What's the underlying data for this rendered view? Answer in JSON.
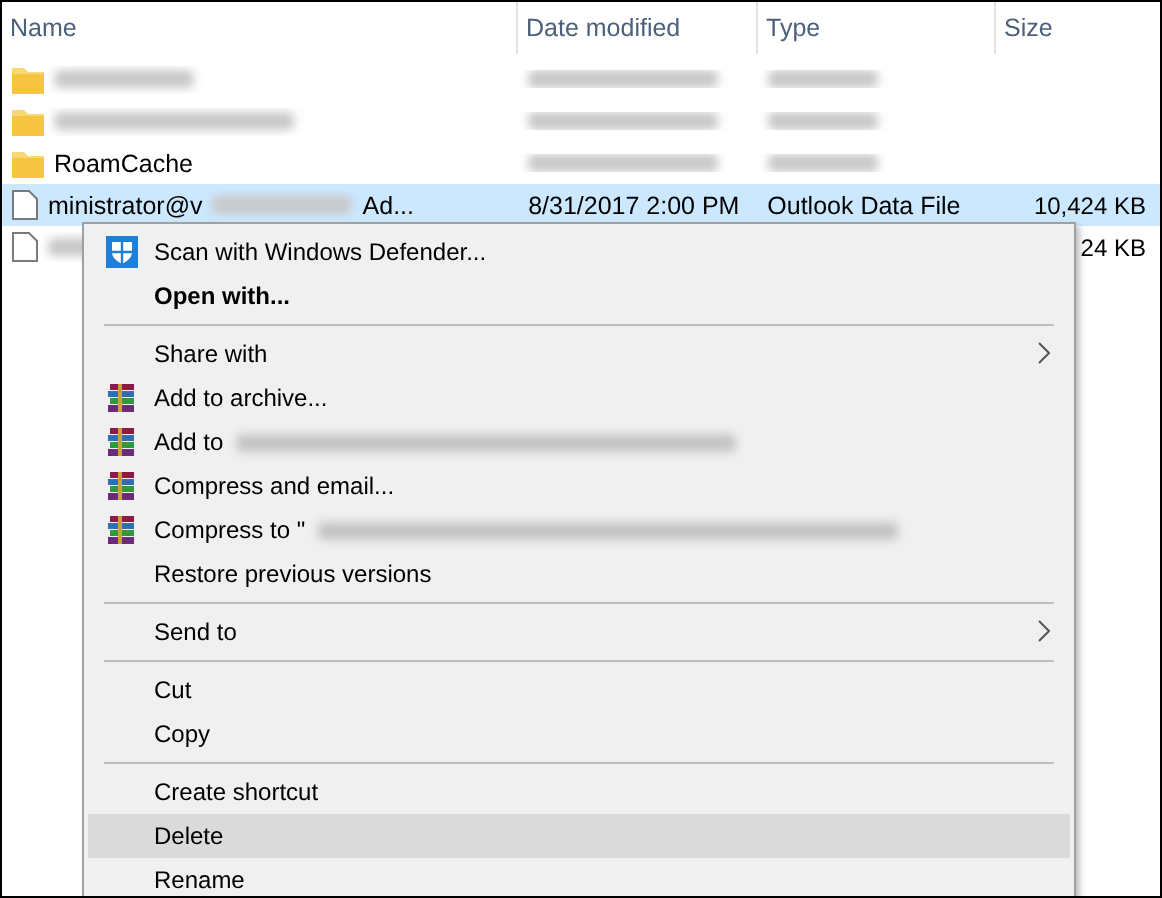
{
  "columns": [
    {
      "label": "Name"
    },
    {
      "label": "Date modified"
    },
    {
      "label": "Type"
    },
    {
      "label": "Size"
    }
  ],
  "rows": [
    {
      "kind": "folder",
      "redacted": true,
      "selected": false
    },
    {
      "kind": "folder",
      "redacted": true,
      "selected": false
    },
    {
      "kind": "folder",
      "name": "RoamCache",
      "redacted": true,
      "selected": false
    },
    {
      "kind": "file",
      "name": "ministrator@v",
      "name_tail": "Ad...",
      "redacted": true,
      "date": "8/31/2017 2:00 PM",
      "type": "Outlook Data File",
      "size": "10,424 KB",
      "selected": true
    },
    {
      "kind": "file",
      "redacted": true,
      "size": "24 KB",
      "selected": false
    }
  ],
  "context_menu": [
    {
      "kind": "defender-item",
      "label": "Scan with Windows Defender...",
      "bold": false,
      "submenu": false,
      "redacted": false,
      "selected": false
    },
    {
      "kind": "item",
      "label": "Open with...",
      "bold": true,
      "submenu": false,
      "redacted": false,
      "selected": false
    },
    {
      "kind": "separator"
    },
    {
      "kind": "item",
      "label": "Share with",
      "bold": false,
      "submenu": true,
      "redacted": false,
      "selected": false
    },
    {
      "kind": "archive-item",
      "label": "Add to archive...",
      "bold": false,
      "submenu": false,
      "redacted": false,
      "selected": false
    },
    {
      "kind": "archive-item",
      "label": "Add to",
      "bold": false,
      "submenu": false,
      "redacted": true,
      "selected": false
    },
    {
      "kind": "archive-item",
      "label": "Compress and email...",
      "bold": false,
      "submenu": false,
      "redacted": false,
      "selected": false
    },
    {
      "kind": "archive-item",
      "label": "Compress to \"",
      "bold": false,
      "submenu": false,
      "redacted": true,
      "selected": false
    },
    {
      "kind": "item",
      "label": "Restore previous versions",
      "bold": false,
      "submenu": false,
      "redacted": false,
      "selected": false
    },
    {
      "kind": "separator"
    },
    {
      "kind": "item",
      "label": "Send to",
      "bold": false,
      "submenu": true,
      "redacted": false,
      "selected": false
    },
    {
      "kind": "separator"
    },
    {
      "kind": "item",
      "label": "Cut",
      "bold": false,
      "submenu": false,
      "redacted": false,
      "selected": false
    },
    {
      "kind": "item",
      "label": "Copy",
      "bold": false,
      "submenu": false,
      "redacted": false,
      "selected": false
    },
    {
      "kind": "separator"
    },
    {
      "kind": "item",
      "label": "Create shortcut",
      "bold": false,
      "submenu": false,
      "redacted": false,
      "selected": false
    },
    {
      "kind": "item",
      "label": "Delete",
      "bold": false,
      "submenu": false,
      "redacted": false,
      "selected": true
    },
    {
      "kind": "item",
      "label": "Rename",
      "bold": false,
      "submenu": false,
      "redacted": false,
      "selected": false
    }
  ]
}
